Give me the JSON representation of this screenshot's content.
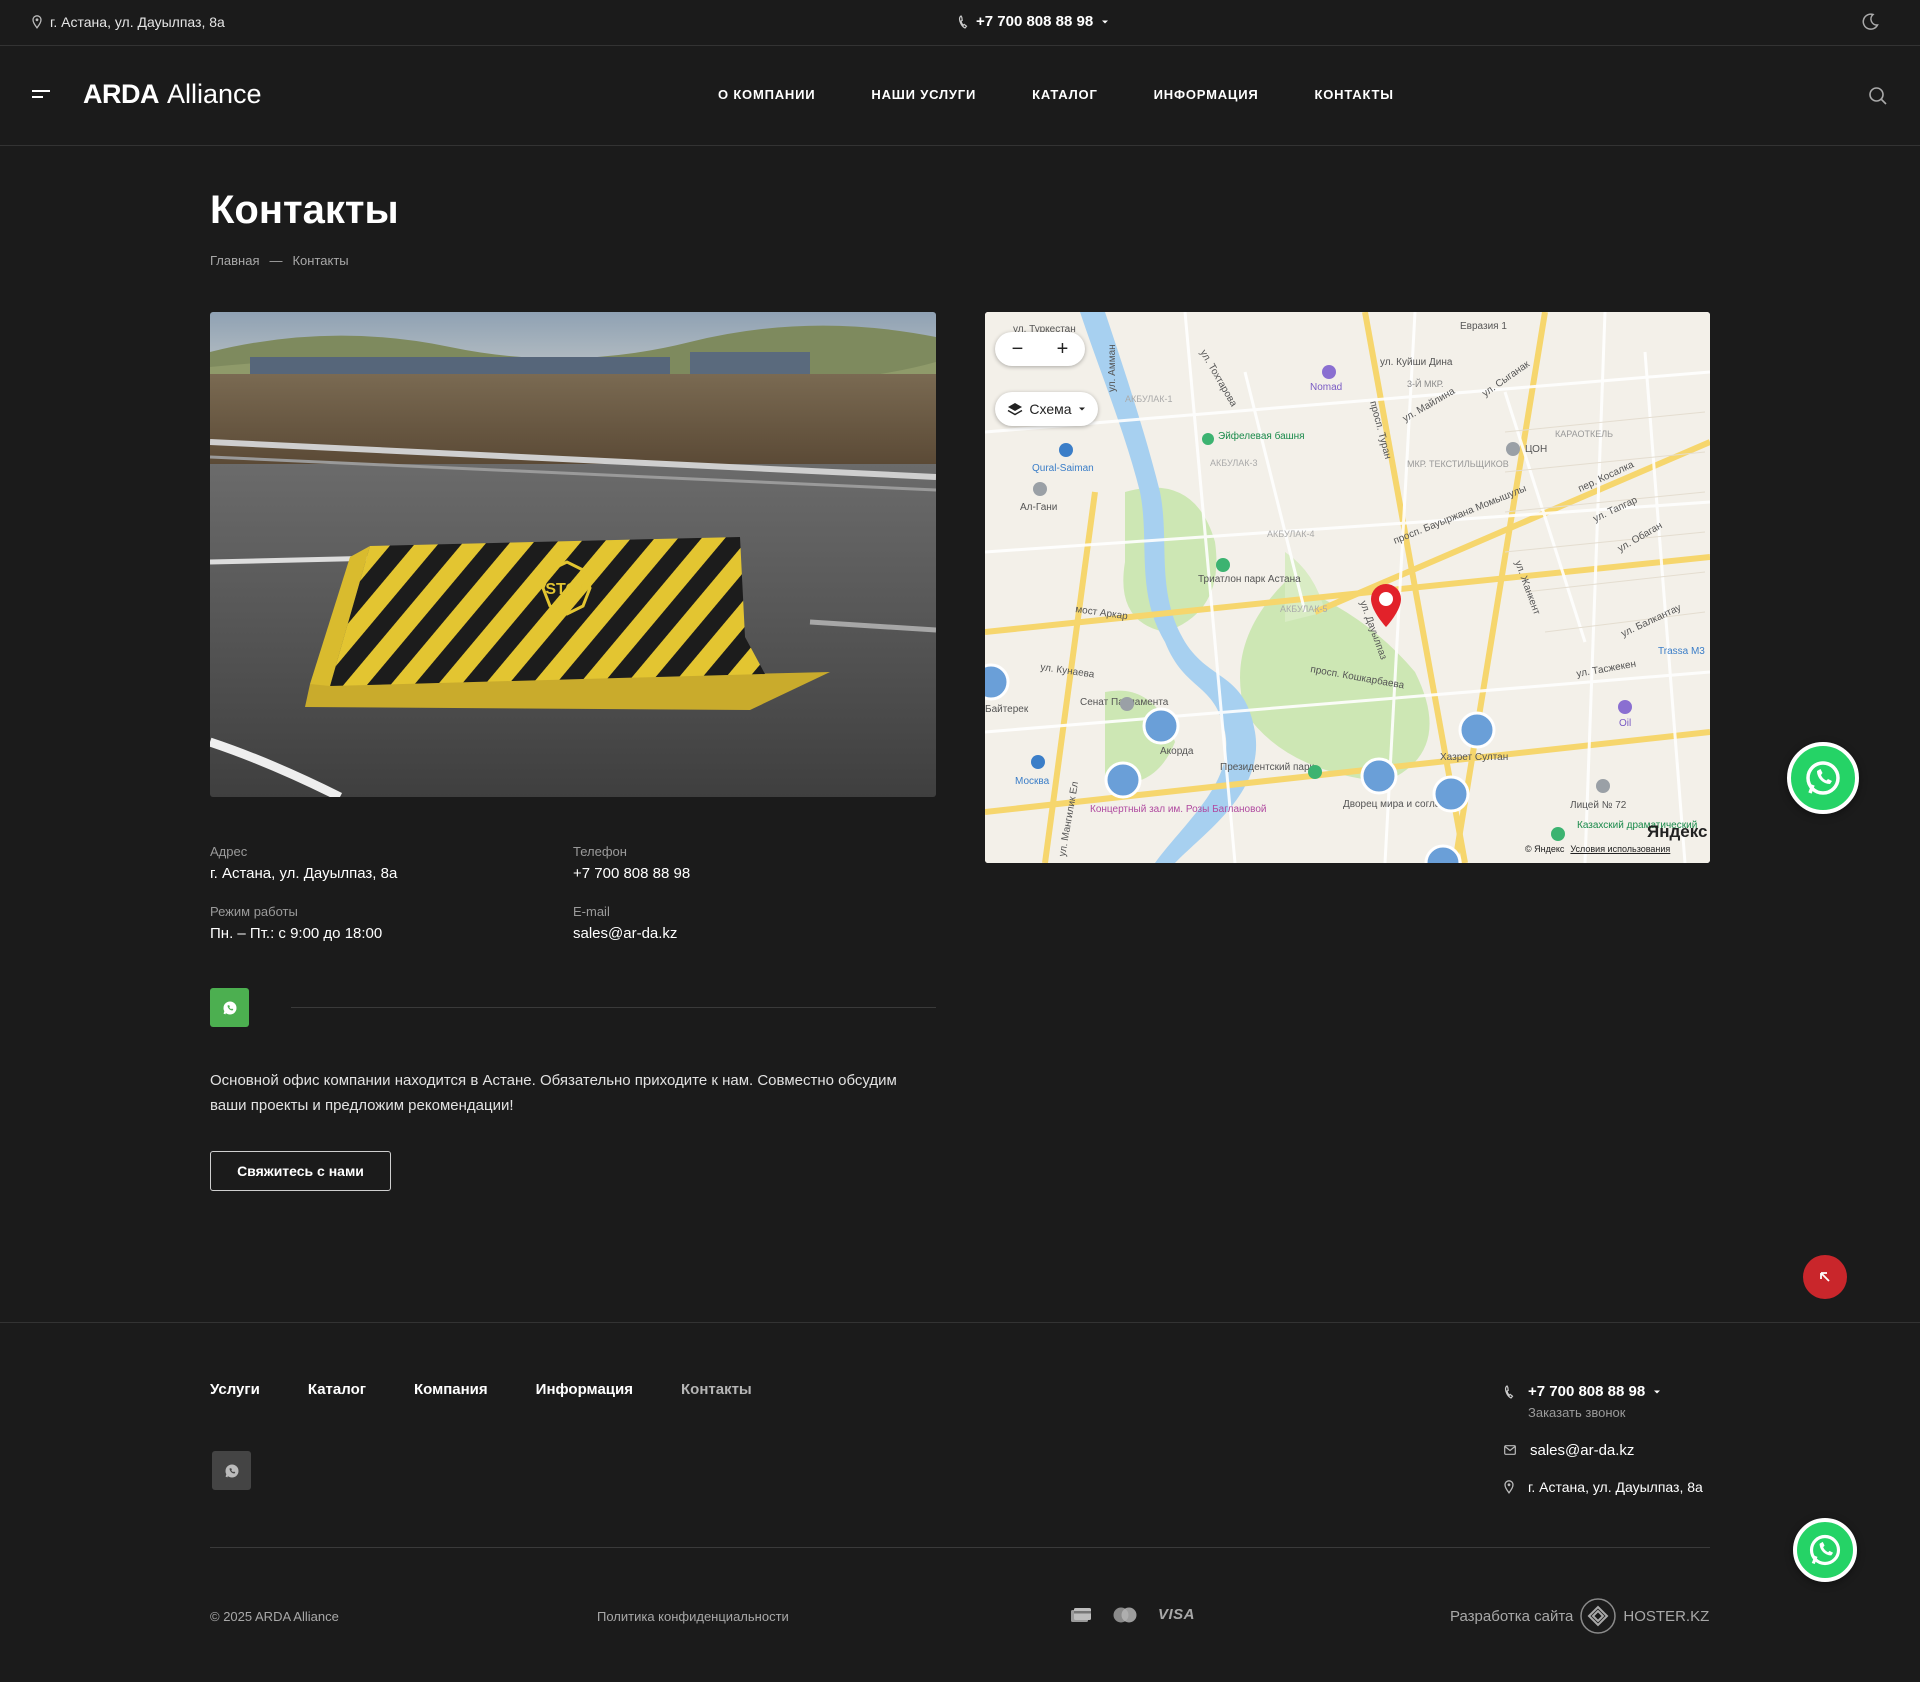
{
  "topbar": {
    "address": "г. Астана, ул. Дауылпаз, 8а",
    "phone": "+7 700 808 88 98"
  },
  "header": {
    "logo_bold": "ARDA",
    "logo_light": "Alliance",
    "nav": [
      "О КОМПАНИИ",
      "НАШИ УСЛУГИ",
      "КАТАЛОГ",
      "ИНФОРМАЦИЯ",
      "КОНТАКТЫ"
    ]
  },
  "page": {
    "title": "Контакты",
    "breadcrumb": [
      "Главная",
      "—",
      "Контакты"
    ]
  },
  "photo": {
    "stop_text": "STOP"
  },
  "contacts": {
    "address_label": "Адрес",
    "address_value": "г. Астана, ул. Дауылпаз, 8а",
    "phone_label": "Телефон",
    "phone_value": "+7 700 808 88 98",
    "hours_label": "Режим работы",
    "hours_value": "Пн. – Пт.: с 9:00 до 18:00",
    "email_label": "E-mail",
    "email_value": "sales@ar-da.kz"
  },
  "description": "Основной офис компании находится в Астане. Обязательно приходите к нам. Совместно обсудим ваши проекты и предложим рекомендации!",
  "cta_label": "Свяжитесь с нами",
  "map": {
    "zoom_out": "−",
    "zoom_in": "+",
    "layer_label": "Схема",
    "brand": "Яндекс",
    "copyright": "© Яндекс",
    "terms": "Условия использования",
    "labels": [
      "ул. Амман",
      "ул. Туркестан",
      "ул. Тохтарова",
      "Евразия 1",
      "ул. Куйши Дина",
      "Nomad",
      "ул. Майлина",
      "ул. Сыганак",
      "3-Й МКР.",
      "Эйфелевая башня",
      "Qural-Saiman",
      "Ал-Гани",
      "АКБУЛАК-1",
      "АКБУЛАК-3",
      "АКБУЛАК-4",
      "АКБУЛАК-5",
      "МКР. ТЕКСТИЛЬЩИКОВ",
      "ЦОН",
      "КАРАОТКЕЛЬ",
      "просп. Туран",
      "просп. Бауыржана Момышулы",
      "пер. Косалка",
      "ул. Тапгар",
      "ул. Обаган",
      "ул. Жанкент",
      "ул. Балкантау",
      "Триатлон парк Астана",
      "мост Аркар",
      "ул. Кунаева",
      "Сенат Парламента",
      "Акорда",
      "Президентский парк",
      "просп. Кошкарбаева",
      "ул. Тасжекен",
      "Trassa M3",
      "Oil",
      "Хазрет Султан",
      "Москва",
      "Концертный зал им. Розы Баглановой",
      "Дворец мира и согласия",
      "Лицей № 72",
      "Казахский драматический",
      "ул. Дауылпаз",
      "Байтерек",
      "ул. Мангилик Ел"
    ]
  },
  "footer": {
    "nav": [
      "Услуги",
      "Каталог",
      "Компания",
      "Информация",
      "Контакты"
    ],
    "phone": "+7 700 808 88 98",
    "callback": "Заказать звонок",
    "email": "sales@ar-da.kz",
    "address": "г. Астана, ул. Дауылпаз, 8а",
    "copyright": "© 2025 ARDA Alliance",
    "policy": "Политика конфиденциальности",
    "visa": "VISA",
    "dev_label": "Разработка сайта",
    "dev_brand": "HOSTER.KZ"
  }
}
